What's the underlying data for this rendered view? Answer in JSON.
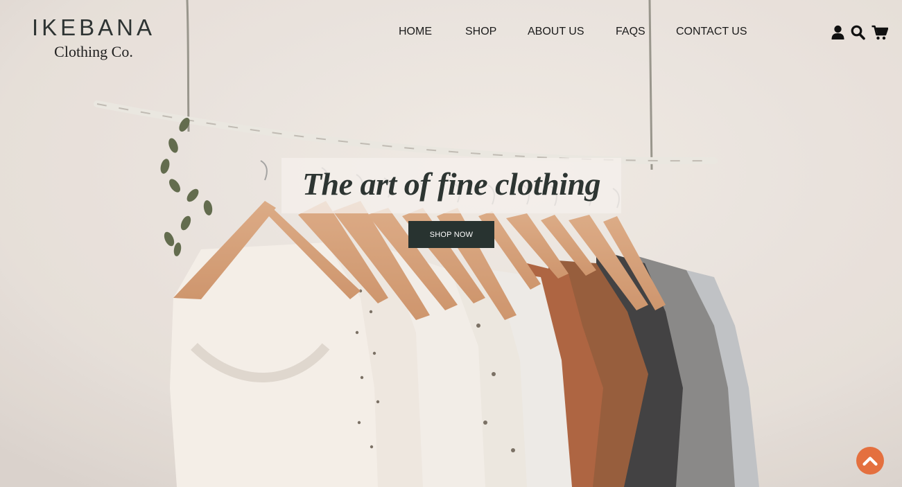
{
  "brand": {
    "name": "IKEBANA",
    "tagline": "Clothing Co."
  },
  "nav": {
    "items": [
      {
        "label": "HOME"
      },
      {
        "label": "SHOP"
      },
      {
        "label": "ABOUT US"
      },
      {
        "label": "FAQS"
      },
      {
        "label": "CONTACT US"
      }
    ]
  },
  "header_icons": [
    "user-icon",
    "search-icon",
    "cart-icon"
  ],
  "hero": {
    "headline": "The art of fine clothing",
    "cta_label": "SHOP NOW"
  },
  "scroll_top_icon": "chevron-up-icon",
  "colors": {
    "accent": "#e4703f",
    "cta_background": "#283330",
    "text_dark": "#1a1a1a"
  }
}
